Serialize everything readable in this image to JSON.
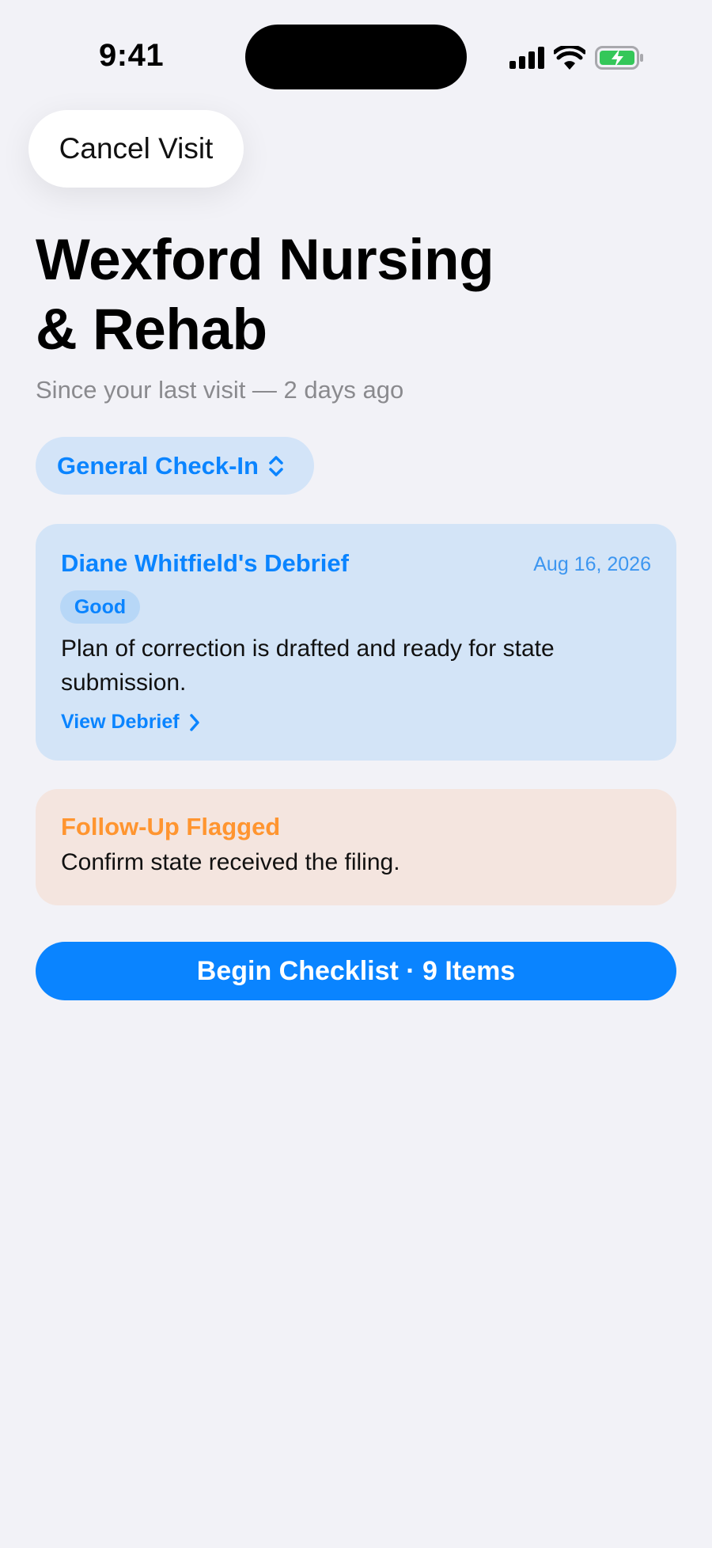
{
  "status_bar": {
    "time": "9:41",
    "icons": [
      "cellular-signal-icon",
      "wifi-icon",
      "battery-charging-icon"
    ],
    "battery_color": "#34C759"
  },
  "nav": {
    "cancel_label": "Cancel Visit"
  },
  "header": {
    "title_line1": "Wexford Nursing",
    "title_line2": "& Rehab",
    "subtitle": "Since your last visit — 2 days ago"
  },
  "visit_type": {
    "selected": "General Check-In",
    "icon": "chevron-up-down-icon"
  },
  "debrief": {
    "title": "Diane Whitfield's Debrief",
    "date": "Aug 16, 2026",
    "status_badge": "Good",
    "summary": "Plan of correction is drafted and ready for state submission.",
    "link_label": "View Debrief",
    "link_icon": "chevron-right-icon"
  },
  "followup": {
    "title": "Follow-Up Flagged",
    "body": "Confirm state received the filing."
  },
  "primary_action": {
    "label": "Begin Checklist · 9 Items"
  },
  "colors": {
    "accent": "#0A84FF",
    "warning": "#FF9530",
    "background": "#F2F2F7",
    "card_blue": "#D3E4F7",
    "card_orange": "#F4E5DF"
  }
}
